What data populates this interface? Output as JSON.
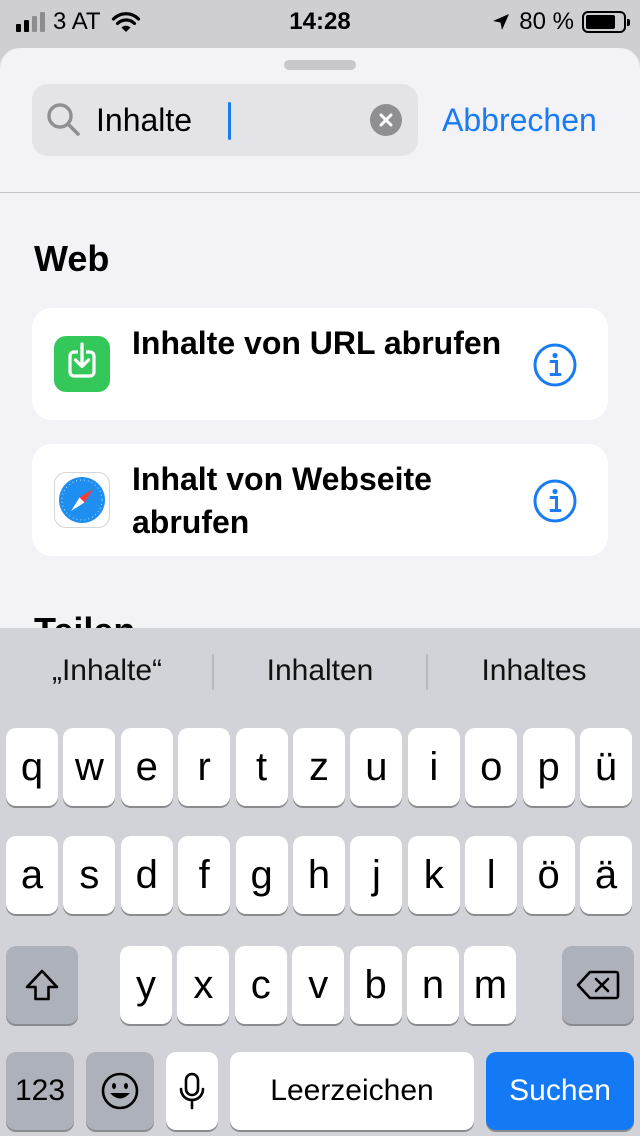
{
  "status_bar": {
    "carrier": "3 AT",
    "time": "14:28",
    "battery_percent": "80 %",
    "battery_level": 0.8,
    "signal_bars": 2
  },
  "search": {
    "value": "Inhalte",
    "cancel_label": "Abbrechen"
  },
  "sections": [
    {
      "title": "Web",
      "items": [
        {
          "label": "Inhalte von URL abrufen",
          "icon": "download-icon"
        },
        {
          "label": "Inhalt von Webseite abrufen",
          "icon": "safari-compass-icon"
        }
      ]
    },
    {
      "title": "Teilen"
    }
  ],
  "keyboard": {
    "suggestions": [
      "„Inhalte“",
      "Inhalten",
      "Inhaltes"
    ],
    "row1": [
      "q",
      "w",
      "e",
      "r",
      "t",
      "z",
      "u",
      "i",
      "o",
      "p",
      "ü"
    ],
    "row2": [
      "a",
      "s",
      "d",
      "f",
      "g",
      "h",
      "j",
      "k",
      "l",
      "ö",
      "ä"
    ],
    "row3": [
      "y",
      "x",
      "c",
      "v",
      "b",
      "n",
      "m"
    ],
    "numbers_label": "123",
    "space_label": "Leerzeichen",
    "return_label": "Suchen"
  },
  "colors": {
    "accent": "#1a7cf4",
    "download_icon_bg": "#34c759",
    "sheet_bg": "#f2f2f7",
    "keyboard_bg": "#d1d3d9"
  }
}
